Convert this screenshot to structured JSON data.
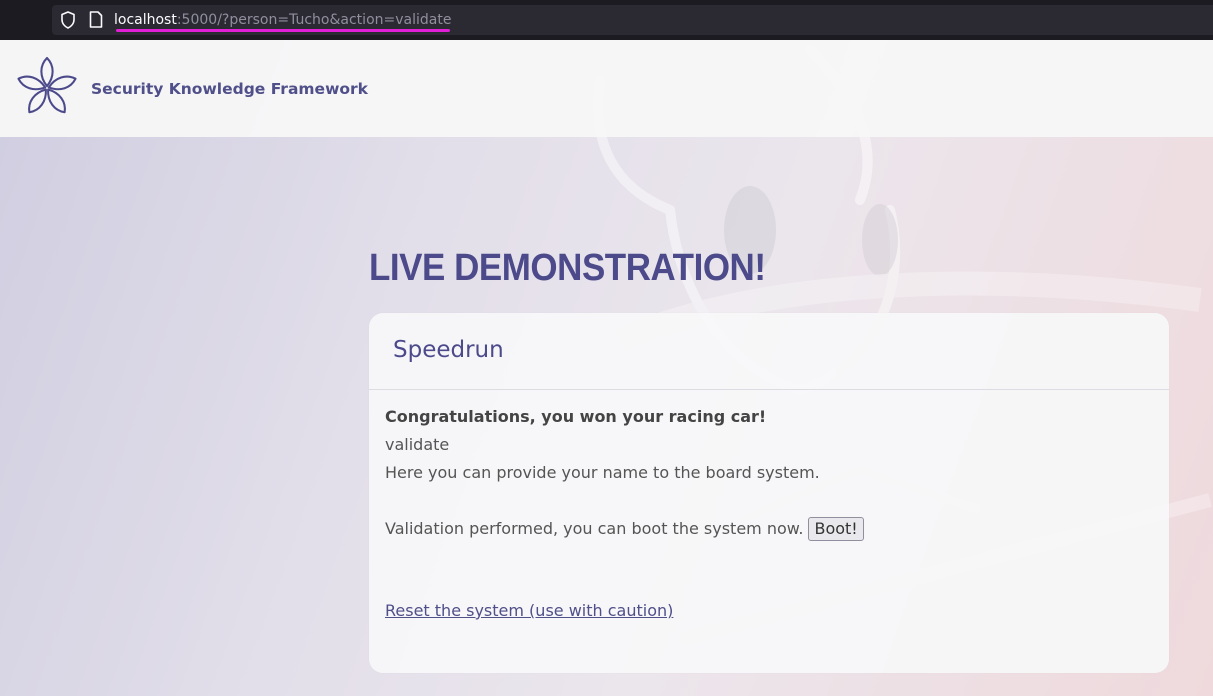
{
  "browser": {
    "url_host": "localhost",
    "url_rest": ":5000/?person=Tucho&action=validate"
  },
  "header": {
    "site_title": "Security Knowledge Framework"
  },
  "main": {
    "heading": "LIVE DEMONSTRATION!",
    "card": {
      "title": "Speedrun",
      "congrats": "Congratulations, you won your racing car!",
      "action_echo": "validate",
      "instructions": "Here you can provide your name to the board system.",
      "validation_text": "Validation performed, you can boot the system now.",
      "boot_button_label": "Boot!",
      "reset_link": "Reset the system (use with caution)"
    }
  },
  "colors": {
    "brand": "#4c4a8b",
    "url_highlight": "#e01fd6",
    "browser_chrome": "#1c1b22"
  }
}
